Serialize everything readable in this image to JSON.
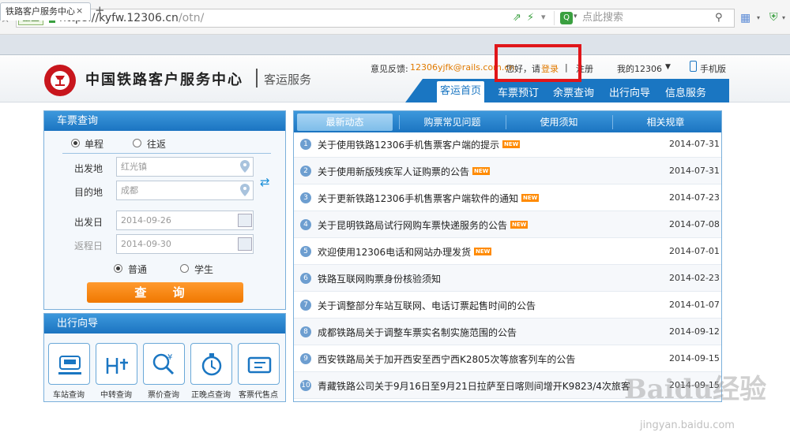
{
  "browser": {
    "ent_badge": "企业",
    "url_main": "https://kyfw.12306.cn",
    "url_path": "/otn/",
    "search_placeholder": "点此搜索",
    "tab_title": "铁路客户服务中心",
    "tab_close": "×",
    "new_tab": "+"
  },
  "header": {
    "brand": "中国铁路客户服务中心",
    "sub": "客运服务",
    "feedback_label": "意见反馈:",
    "feedback_email": "12306yjfk@rails.com.cn",
    "hello": "您好，请",
    "login": "登录",
    "divider": "|",
    "register": "注册",
    "my12306": "我的12306",
    "mobile": "手机版"
  },
  "nav": {
    "items": [
      "客运首页",
      "车票预订",
      "余票查询",
      "出行向导",
      "信息服务"
    ]
  },
  "ticket": {
    "title": "车票查询",
    "oneway": "单程",
    "roundtrip": "往返",
    "from_label": "出发地",
    "from_value": "红光镇",
    "to_label": "目的地",
    "to_value": "成都",
    "depart_label": "出发日",
    "depart_value": "2014-09-26",
    "return_label": "返程日",
    "return_value": "2014-09-30",
    "normal": "普通",
    "student": "学生",
    "query": "查 询"
  },
  "guide": {
    "title": "出行向导",
    "items": [
      "车站查询",
      "中转查询",
      "票价查询",
      "正晚点查询",
      "客票代售点"
    ]
  },
  "news": {
    "tabs": [
      "最新动态",
      "购票常见问题",
      "使用须知",
      "相关规章"
    ],
    "new_badge": "NEW",
    "rows": [
      {
        "n": "1",
        "t": "关于使用铁路12306手机售票客户端的提示",
        "new": true,
        "d": "2014-07-31"
      },
      {
        "n": "2",
        "t": "关于使用新版残疾军人证购票的公告",
        "new": true,
        "d": "2014-07-31"
      },
      {
        "n": "3",
        "t": "关于更新铁路12306手机售票客户端软件的通知",
        "new": true,
        "d": "2014-07-23"
      },
      {
        "n": "4",
        "t": "关于昆明铁路局试行网购车票快递服务的公告",
        "new": true,
        "d": "2014-07-08"
      },
      {
        "n": "5",
        "t": "欢迎使用12306电话和网站办理发货",
        "new": true,
        "d": "2014-07-01"
      },
      {
        "n": "6",
        "t": "铁路互联网购票身份核验须知",
        "new": false,
        "d": "2014-02-23"
      },
      {
        "n": "7",
        "t": "关于调整部分车站互联网、电话订票起售时间的公告",
        "new": false,
        "d": "2014-01-07"
      },
      {
        "n": "8",
        "t": "成都铁路局关于调整车票实名制实施范围的公告",
        "new": false,
        "d": "2014-09-12"
      },
      {
        "n": "9",
        "t": "西安铁路局关于加开西安至西宁西K2805次等旅客列车的公告",
        "new": false,
        "d": "2014-09-15"
      },
      {
        "n": "10",
        "t": "青藏铁路公司关于9月16日至9月21日拉萨至日喀则间增开K9823/4次旅客",
        "new": false,
        "d": "2014-09-15"
      }
    ]
  },
  "watermark": {
    "main": "Baidu经验",
    "sub": "jingyan.baidu.com"
  },
  "colors": {
    "brand_blue": "#1a76c2",
    "accent_orange": "#f07800",
    "highlight_red": "#e0161a",
    "logo_red": "#c8161d"
  }
}
